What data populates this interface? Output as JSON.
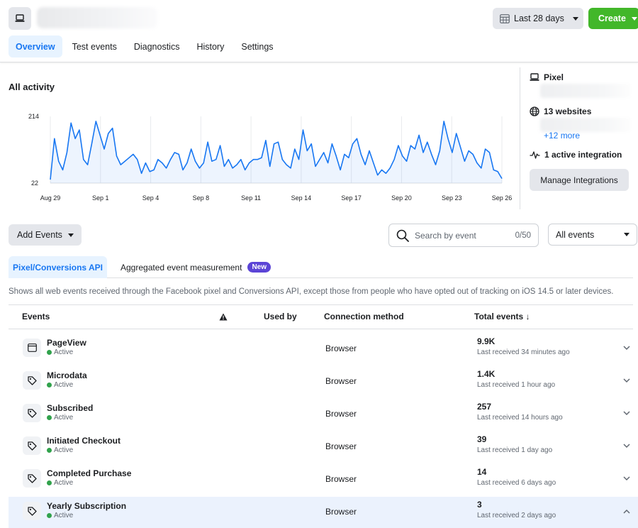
{
  "header": {
    "date_range": "Last 28 days",
    "create_label": "Create"
  },
  "tabs": [
    {
      "label": "Overview",
      "active": true
    },
    {
      "label": "Test events",
      "active": false
    },
    {
      "label": "Diagnostics",
      "active": false
    },
    {
      "label": "History",
      "active": false
    },
    {
      "label": "Settings",
      "active": false
    }
  ],
  "activity": {
    "title": "All activity",
    "chart_data": {
      "type": "line",
      "ylim": [
        22,
        214
      ],
      "yticks": [
        22,
        214
      ],
      "xticks": [
        "Aug 29",
        "Sep 1",
        "Sep 4",
        "Sep 8",
        "Sep 11",
        "Sep 14",
        "Sep 17",
        "Sep 20",
        "Sep 23",
        "Sep 26"
      ],
      "values": [
        32,
        150,
        85,
        60,
        110,
        195,
        150,
        175,
        90,
        75,
        135,
        200,
        160,
        120,
        165,
        180,
        100,
        75,
        85,
        95,
        105,
        90,
        50,
        80,
        55,
        60,
        90,
        80,
        65,
        90,
        110,
        105,
        60,
        80,
        120,
        85,
        65,
        80,
        140,
        85,
        90,
        130,
        70,
        90,
        65,
        75,
        90,
        60,
        80,
        90,
        90,
        95,
        145,
        70,
        135,
        140,
        90,
        75,
        65,
        120,
        90,
        175,
        115,
        135,
        70,
        90,
        110,
        80,
        135,
        100,
        60,
        105,
        95,
        135,
        150,
        105,
        75,
        115,
        80,
        45,
        60,
        50,
        65,
        90,
        130,
        100,
        85,
        130,
        120,
        160,
        110,
        140,
        105,
        75,
        115,
        200,
        150,
        110,
        165,
        125,
        85,
        115,
        105,
        80,
        65,
        120,
        110,
        60,
        55,
        35
      ]
    }
  },
  "side_panel": {
    "pixel_label": "Pixel",
    "websites_label": "13 websites",
    "more_link": "+12 more",
    "integration_label": "1 active integration",
    "manage_button": "Manage Integrations"
  },
  "toolbar": {
    "add_events": "Add Events",
    "search_placeholder": "Search by event",
    "search_counter": "0/50",
    "filter": "All events"
  },
  "subtabs": {
    "primary": "Pixel/Conversions API",
    "secondary": "Aggregated event measurement",
    "badge": "New"
  },
  "description": "Shows all web events received through the Facebook pixel and Conversions API, except those from people who have opted out of tracking on iOS 14.5 or later devices.",
  "table": {
    "headers": {
      "events": "Events",
      "used_by": "Used by",
      "connection": "Connection method",
      "total": "Total events ↓"
    },
    "rows": [
      {
        "name": "PageView",
        "status": "Active",
        "connection": "Browser",
        "total": "9.9K",
        "last": "Last received 34 minutes ago",
        "icon": "window-icon"
      },
      {
        "name": "Microdata",
        "status": "Active",
        "connection": "Browser",
        "total": "1.4K",
        "last": "Last received 1 hour ago",
        "icon": "tag-icon"
      },
      {
        "name": "Subscribed",
        "status": "Active",
        "connection": "Browser",
        "total": "257",
        "last": "Last received 14 hours ago",
        "icon": "tag-icon"
      },
      {
        "name": "Initiated Checkout",
        "status": "Active",
        "connection": "Browser",
        "total": "39",
        "last": "Last received 1 day ago",
        "icon": "tag-icon"
      },
      {
        "name": "Completed Purchase",
        "status": "Active",
        "connection": "Browser",
        "total": "14",
        "last": "Last received 6 days ago",
        "icon": "tag-icon"
      },
      {
        "name": "Yearly Subscription",
        "status": "Active",
        "connection": "Browser",
        "total": "3",
        "last": "Last received 2 days ago",
        "icon": "tag-icon"
      }
    ]
  },
  "colors": {
    "accent": "#1877f2",
    "create": "#42b72a",
    "active_dot": "#31a24c",
    "badge": "#5b44d6"
  }
}
